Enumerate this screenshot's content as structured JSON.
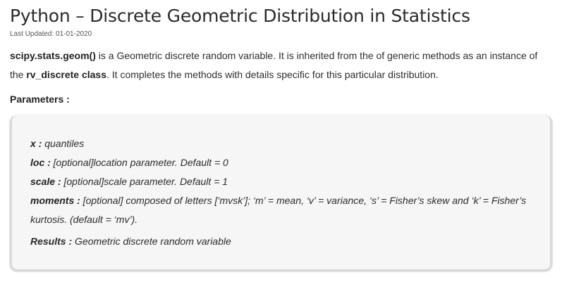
{
  "article": {
    "title": "Python – Discrete Geometric Distribution in Statistics",
    "last_updated": "Last Updated: 01-01-2020",
    "intro": {
      "func_name": "scipy.stats.geom()",
      "text_1": " is a Geometric discrete random variable. It is inherited from the of generic methods as an instance of the ",
      "class_name": "rv_discrete class",
      "text_2": ". It completes the methods with details specific for this particular distribution."
    },
    "parameters_heading": "Parameters :",
    "parameters": [
      {
        "name": "x :",
        "desc": " quantiles"
      },
      {
        "name": "loc :",
        "desc": " [optional]location parameter. Default = 0"
      },
      {
        "name": "scale :",
        "desc": " [optional]scale parameter. Default = 1"
      },
      {
        "name": "moments :",
        "desc": " [optional] composed of letters [‘mvsk’]; ‘m’ = mean, ‘v’ = variance, ‘s’ = Fisher’s skew and ‘k’ = Fisher’s kurtosis. (default = ‘mv’)."
      }
    ],
    "results": {
      "name": "Results :",
      "desc": " Geometric discrete random variable"
    }
  }
}
